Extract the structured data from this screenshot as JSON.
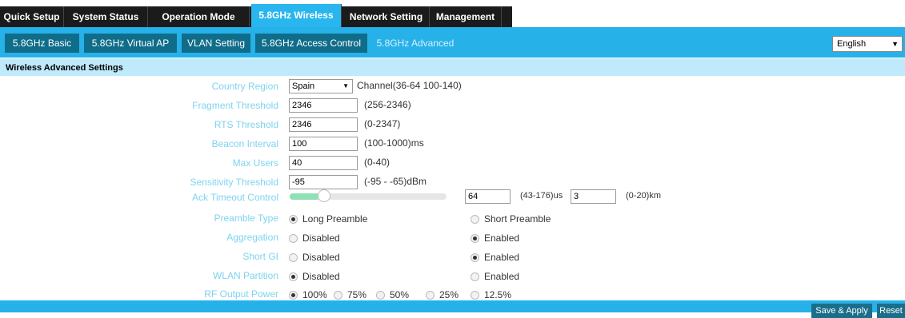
{
  "colors": {
    "nav_bg": "#1b1b1b",
    "accent": "#29b6ee",
    "sub_btn": "#0f6d8a",
    "label": "#7fd3f0",
    "section_bg": "#bfeafb"
  },
  "top_tabs": [
    "Quick Setup",
    "System Status",
    "Operation Mode",
    "5.8GHz Wireless",
    "Network Setting",
    "Management"
  ],
  "top_active": "5.8GHz Wireless",
  "sub_tabs": [
    "5.8GHz Basic",
    "5.8GHz Virtual AP",
    "VLAN Setting",
    "5.8GHz Access Control",
    "5.8GHz Advanced"
  ],
  "sub_active": "5.8GHz Advanced",
  "language": {
    "selected": "English",
    "caret": "▼"
  },
  "section_title": "Wireless Advanced Settings",
  "form": {
    "country_region": {
      "label": "Country Region",
      "value": "Spain",
      "hint": "Channel(36-64 100-140)"
    },
    "fragment_threshold": {
      "label": "Fragment Threshold",
      "value": "2346",
      "hint": "(256-2346)"
    },
    "rts_threshold": {
      "label": "RTS Threshold",
      "value": "2346",
      "hint": "(0-2347)"
    },
    "beacon_interval": {
      "label": "Beacon Interval",
      "value": "100",
      "hint": "(100-1000)ms"
    },
    "max_users": {
      "label": "Max Users",
      "value": "40",
      "hint": "(0-40)"
    },
    "sensitivity_threshold": {
      "label": "Sensitivity Threshold",
      "value": "-95",
      "hint": "(-95 - -65)dBm"
    },
    "ack_timeout": {
      "label": "Ack Timeout Control",
      "slider_fraction": 0.18,
      "us_value": "64",
      "us_hint": "(43-176)us",
      "km_value": "3",
      "km_hint": "(0-20)km"
    },
    "preamble_type": {
      "label": "Preamble Type",
      "options": [
        "Long Preamble",
        "Short Preamble"
      ],
      "selected": 0
    },
    "aggregation": {
      "label": "Aggregation",
      "options": [
        "Disabled",
        "Enabled"
      ],
      "selected": 1
    },
    "short_gi": {
      "label": "Short GI",
      "options": [
        "Disabled",
        "Enabled"
      ],
      "selected": 1
    },
    "wlan_partition": {
      "label": "WLAN Partition",
      "options": [
        "Disabled",
        "Enabled"
      ],
      "selected": 0
    },
    "rf_output_power": {
      "label": "RF Output Power",
      "options": [
        "100%",
        "75%",
        "50%",
        "25%",
        "12.5%"
      ],
      "selected": 0
    }
  },
  "buttons": {
    "save": "Save & Apply",
    "reset": "Reset"
  }
}
